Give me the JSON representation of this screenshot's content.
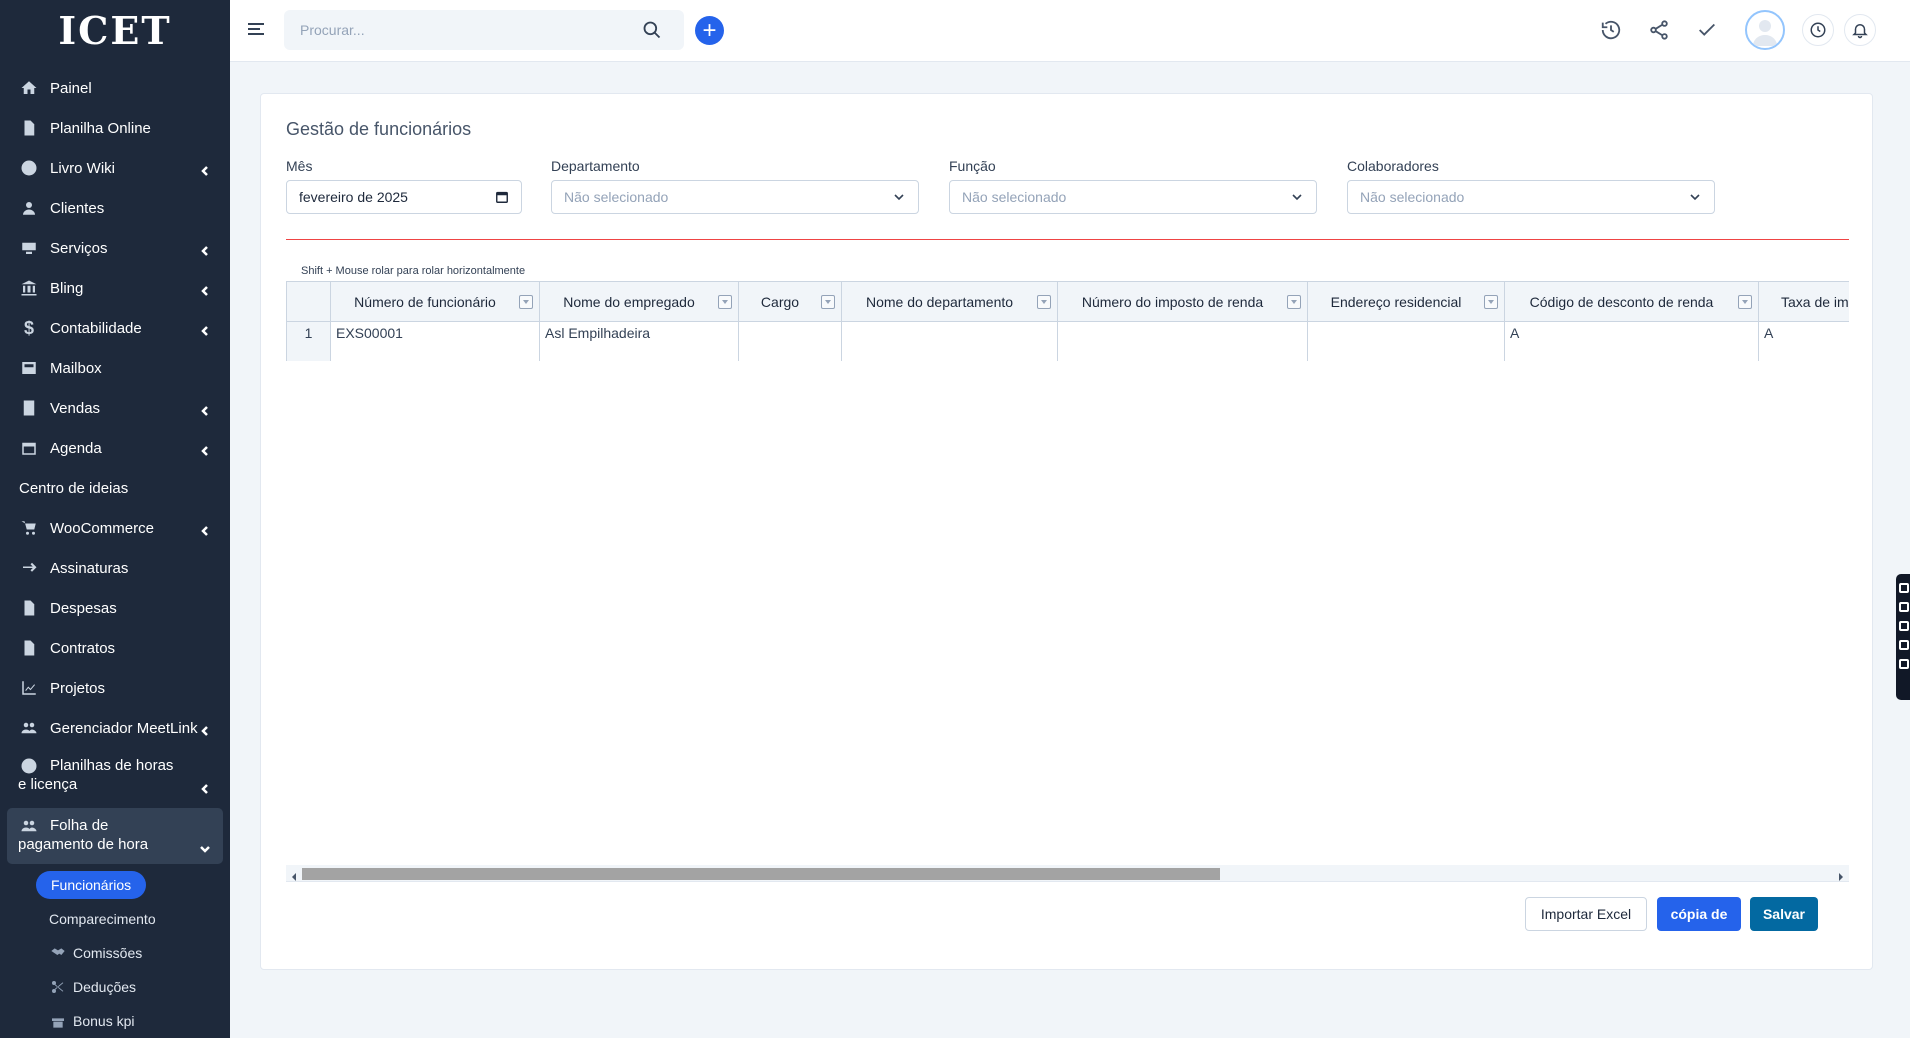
{
  "app": {
    "logo_text": "ICET"
  },
  "sidebar": {
    "items": [
      {
        "label": "Painel",
        "icon": "home-icon"
      },
      {
        "label": "Planilha Online",
        "icon": "file-icon"
      },
      {
        "label": "Livro Wiki",
        "icon": "question-icon",
        "has_children": true
      },
      {
        "label": "Clientes",
        "icon": "user-icon"
      },
      {
        "label": "Serviços",
        "icon": "headset-icon",
        "has_children": true
      },
      {
        "label": "Bling",
        "icon": "bank-icon",
        "has_children": true
      },
      {
        "label": "Contabilidade",
        "icon": "dollar-icon",
        "has_children": true
      },
      {
        "label": "Mailbox",
        "icon": "mailbox-icon"
      },
      {
        "label": "Vendas",
        "icon": "receipt-icon",
        "has_children": true
      },
      {
        "label": "Agenda",
        "icon": "calendar-icon",
        "has_children": true
      },
      {
        "label": "Centro de ideias",
        "icon": ""
      },
      {
        "label": "WooCommerce",
        "icon": "cart-icon",
        "has_children": true
      },
      {
        "label": "Assinaturas",
        "icon": "repeat-icon"
      },
      {
        "label": "Despesas",
        "icon": "file-icon"
      },
      {
        "label": "Contratos",
        "icon": "file-icon"
      },
      {
        "label": "Projetos",
        "icon": "chart-icon"
      },
      {
        "label": "Gerenciador MeetLink",
        "icon": "users-icon",
        "has_children": true
      },
      {
        "label": "Planilhas de horas e licença",
        "icon": "user-circle-icon",
        "has_children": true
      },
      {
        "label": "Folha de pagamento de hora",
        "icon": "users-icon",
        "has_children": true,
        "expanded": true
      }
    ],
    "submenu": [
      {
        "label": "Funcionários",
        "active": true
      },
      {
        "label": "Comparecimento"
      },
      {
        "label": "Comissões",
        "icon": "handshake-icon"
      },
      {
        "label": "Deduções",
        "icon": "scissors-icon"
      },
      {
        "label": "Bonus kpi",
        "icon": "gift-icon"
      }
    ]
  },
  "topbar": {
    "search_placeholder": "Procurar...",
    "icons": [
      "history-icon",
      "share-icon",
      "check-icon",
      "avatar",
      "clock-icon",
      "bell-icon"
    ]
  },
  "page": {
    "title": "Gestão de funcionários",
    "filters": {
      "month_label": "Mês",
      "month_value": "fevereiro de 2025",
      "department_label": "Departamento",
      "department_placeholder": "Não selecionado",
      "role_label": "Função",
      "role_placeholder": "Não selecionado",
      "staff_label": "Colaboradores",
      "staff_placeholder": "Não selecionado"
    },
    "scroll_hint": "Shift + Mouse rolar para rolar horizontalmente",
    "table": {
      "columns": [
        "Número de funcionário",
        "Nome do empregado",
        "Cargo",
        "Nome do departamento",
        "Número do imposto de renda",
        "Endereço residencial",
        "Código de desconto de renda",
        "Taxa de im"
      ],
      "rows": [
        {
          "index": "1",
          "cells": [
            "EXS00001",
            "Asl Empilhadeira",
            "",
            "",
            "",
            "",
            "A",
            "A"
          ]
        }
      ]
    },
    "buttons": {
      "import_excel": "Importar Excel",
      "copy": "cópia de",
      "save": "Salvar"
    },
    "colors": {
      "primary": "#2563eb",
      "sidebar": "#1e293b",
      "divider": "#ef4444",
      "save": "#0369a1"
    }
  }
}
